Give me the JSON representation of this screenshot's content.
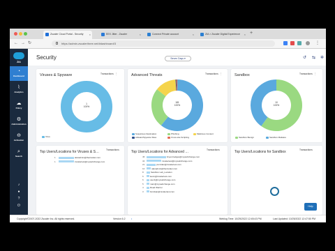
{
  "browser": {
    "tabs": [
      {
        "title": "Zscaler Cloud Portal - Security",
        "color": "#1f6fd8"
      },
      {
        "title": "EEX Jitter - Zscaler",
        "color": "#2a7ad6"
      },
      {
        "title": "Connect Private account",
        "color": "#2b7fd1"
      },
      {
        "title": "ZIA > Zscaler Digital Experience",
        "color": "#2b7fd1"
      }
    ],
    "url": "https://admin.zscalerthree.net/#dashboard/3"
  },
  "sidebar": {
    "logo_label": "ZIA",
    "items": [
      {
        "label": "Dashboard",
        "icon": "speedometer-icon"
      },
      {
        "label": "Analytics",
        "icon": "chart-icon"
      },
      {
        "label": "Policy",
        "icon": "cloud-icon"
      },
      {
        "label": "Administration",
        "icon": "gear-icon"
      },
      {
        "label": "Activation",
        "icon": "activation-icon"
      },
      {
        "label": "Search",
        "icon": "search-icon"
      }
    ]
  },
  "header": {
    "title": "Security",
    "range": "Seven Days ▾"
  },
  "cards": {
    "viruses": {
      "title": "Viruses & Spyware",
      "tag": "Transactions",
      "center": [
        "1",
        "100%"
      ],
      "legend": [
        "Virus"
      ]
    },
    "threats": {
      "title": "Advanced Threats",
      "tag": "Transactions",
      "center": [
        "181",
        "100%"
      ],
      "legend": [
        "Suspicious Destination",
        "Phishing",
        "Malicious Content",
        "Adware/Spyware Sites",
        "Cross-site Scripting"
      ]
    },
    "sandbox": {
      "title": "Sandbox",
      "tag": "Transactions",
      "center": [
        "10",
        "100%"
      ],
      "legend": [
        "Sandbox Benign",
        "Sandbox Malware"
      ]
    },
    "top_viruses": {
      "title": "Top Users/Locations for Viruses & S…",
      "tag": "Transactions",
      "rows": [
        {
          "n": "1",
          "label": "alanadmin@thezscaler.com"
        },
        {
          "n": "1",
          "label": "zscalertest@mywebchange.com"
        }
      ]
    },
    "top_threats": {
      "title": "Top Users/Locations for Advanced …",
      "tag": "Transactions",
      "rows": [
        {
          "n": "45",
          "label": "bryan.hedges@mywebchange.com"
        },
        {
          "n": "34",
          "label": "zscalertest@mywebchange.com"
        },
        {
          "n": "21",
          "label": "jmcmilan@zscalertest.com"
        },
        {
          "n": "10",
          "label": "alanadmin@thezscaler.com"
        },
        {
          "n": "8",
          "label": "Sandbox Lab_Location"
        },
        {
          "n": "6",
          "label": "kevin@zscalertest.com"
        },
        {
          "n": "6",
          "label": "user1@mywebchange.com"
        },
        {
          "n": "5",
          "label": "marc@mywebchange.com"
        },
        {
          "n": "4",
          "label": "Road Warrior"
        },
        {
          "n": "3",
          "label": "bmickan@zscalertest.com"
        }
      ]
    },
    "top_sandbox": {
      "title": "Top Users/Locations for Sandbox",
      "tag": "Transactions"
    }
  },
  "help": "Help",
  "footer": {
    "copyright": "Copyright©2007-2022 Zscaler Inc. All rights reserved.",
    "version": "Version 6.2",
    "weblog": "Weblog Time: 10/25/2022 12:45:43 PM",
    "updated": "Last Updated: 10/25/2022 12:47:50 PM"
  },
  "colors": {
    "virus": "#67bce6",
    "suspicious": "#5aa9de",
    "phishing": "#9ad981",
    "malicious": "#f5d44c",
    "adware": "#2f4f8a",
    "xss": "#e36a4f",
    "benign": "#9ad981",
    "malware": "#5aa9de"
  },
  "chart_data": [
    {
      "type": "pie",
      "title": "Viruses & Spyware",
      "categories": [
        "Virus"
      ],
      "values": [
        1
      ]
    },
    {
      "type": "pie",
      "title": "Advanced Threats",
      "categories": [
        "Suspicious Destination",
        "Phishing",
        "Malicious Content",
        "Adware/Spyware Sites",
        "Cross-site Scripting"
      ],
      "values": [
        110,
        45,
        24,
        1,
        1
      ]
    },
    {
      "type": "pie",
      "title": "Sandbox",
      "categories": [
        "Sandbox Benign",
        "Sandbox Malware"
      ],
      "values": [
        6,
        4
      ]
    },
    {
      "type": "bar",
      "title": "Top Users/Locations for Advanced …",
      "categories": [
        "bryan.hedges@mywebchange.com",
        "zscalertest@mywebchange.com",
        "jmcmilan@zscalertest.com",
        "alanadmin@thezscaler.com",
        "Sandbox Lab_Location",
        "kevin@zscalertest.com",
        "user1@mywebchange.com",
        "marc@mywebchange.com",
        "Road Warrior",
        "bmickan@zscalertest.com"
      ],
      "values": [
        45,
        34,
        21,
        10,
        8,
        6,
        6,
        5,
        4,
        3
      ]
    }
  ]
}
